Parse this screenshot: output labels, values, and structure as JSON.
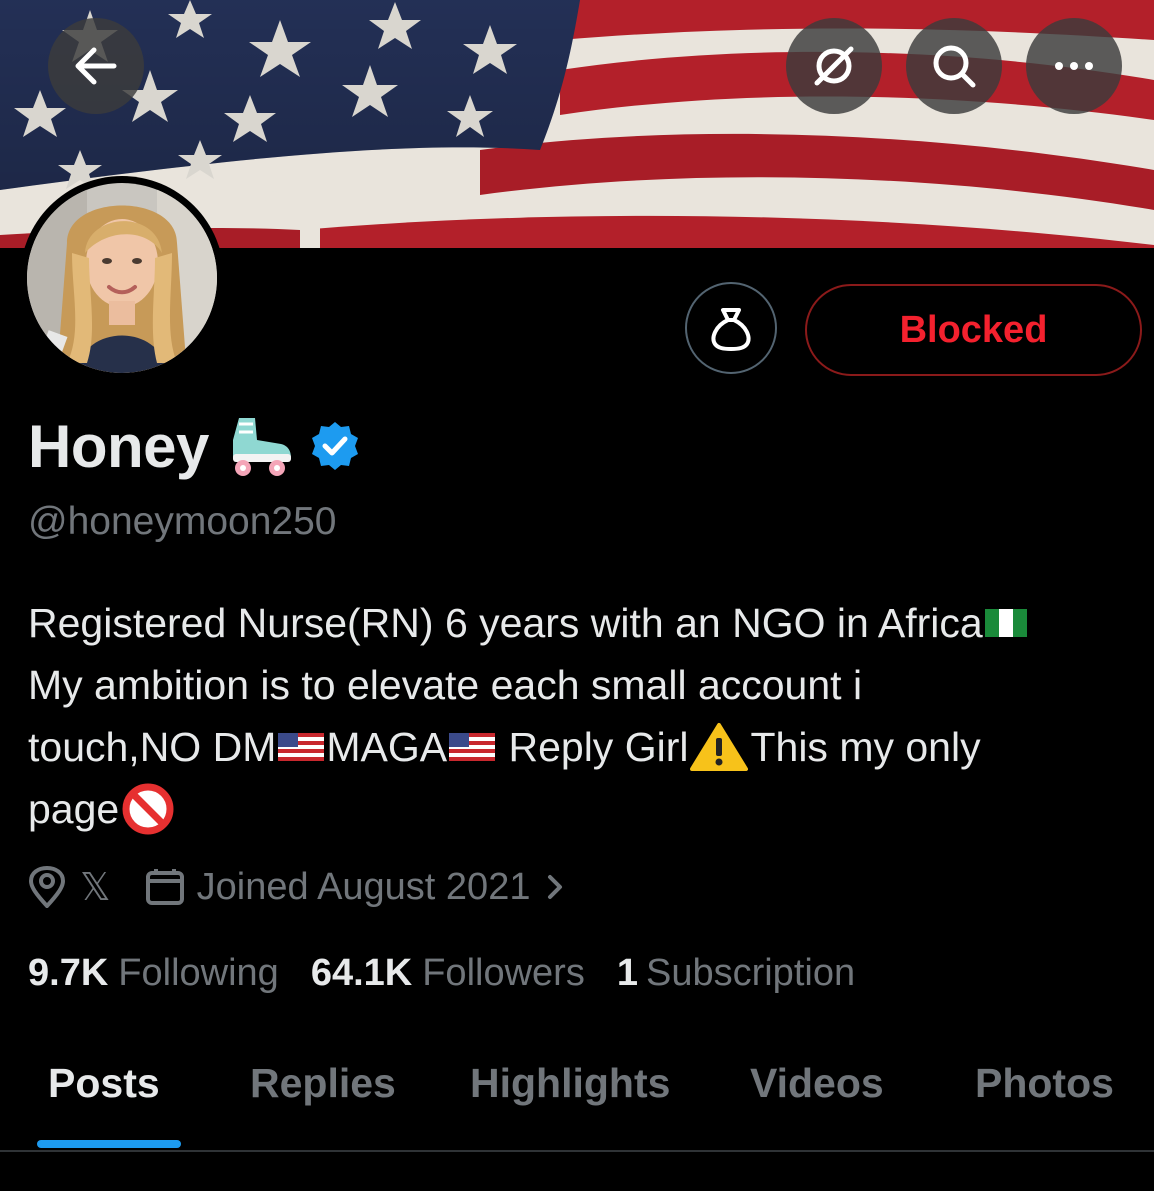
{
  "header": {
    "back_icon": "arrow-left-icon",
    "grok_icon": "grok-icon",
    "search_icon": "search-icon",
    "more_icon": "more-icon"
  },
  "profile": {
    "display_name": "Honey",
    "name_emoji_icon": "roller-skate-icon",
    "verified_icon": "verified-badge-icon",
    "verified_color": "#1d9bf0",
    "handle": "@honeymoon250",
    "bio": {
      "line1": "Registered Nurse(RN) 6 years with an NGO in Africa",
      "line2": "My ambition is to elevate each small account i",
      "line3a": "touch,NO DM",
      "line3b": "MAGA",
      "line3c": " Reply Girl",
      "line3d": "This my only",
      "line4": "page"
    },
    "location": "𝕏",
    "joined": "Joined August 2021"
  },
  "actions": {
    "gift_icon": "money-bag-icon",
    "blocked_label": "Blocked",
    "blocked_color": "#f4212e"
  },
  "stats": {
    "following_count": "9.7K",
    "following_label": "Following",
    "followers_count": "64.1K",
    "followers_label": "Followers",
    "subscription_count": "1",
    "subscription_label": "Subscription"
  },
  "tabs": [
    {
      "label": "Posts",
      "active": true
    },
    {
      "label": "Replies",
      "active": false
    },
    {
      "label": "Highlights",
      "active": false
    },
    {
      "label": "Videos",
      "active": false
    },
    {
      "label": "Photos",
      "active": false
    }
  ],
  "accent_color": "#1d9bf0"
}
